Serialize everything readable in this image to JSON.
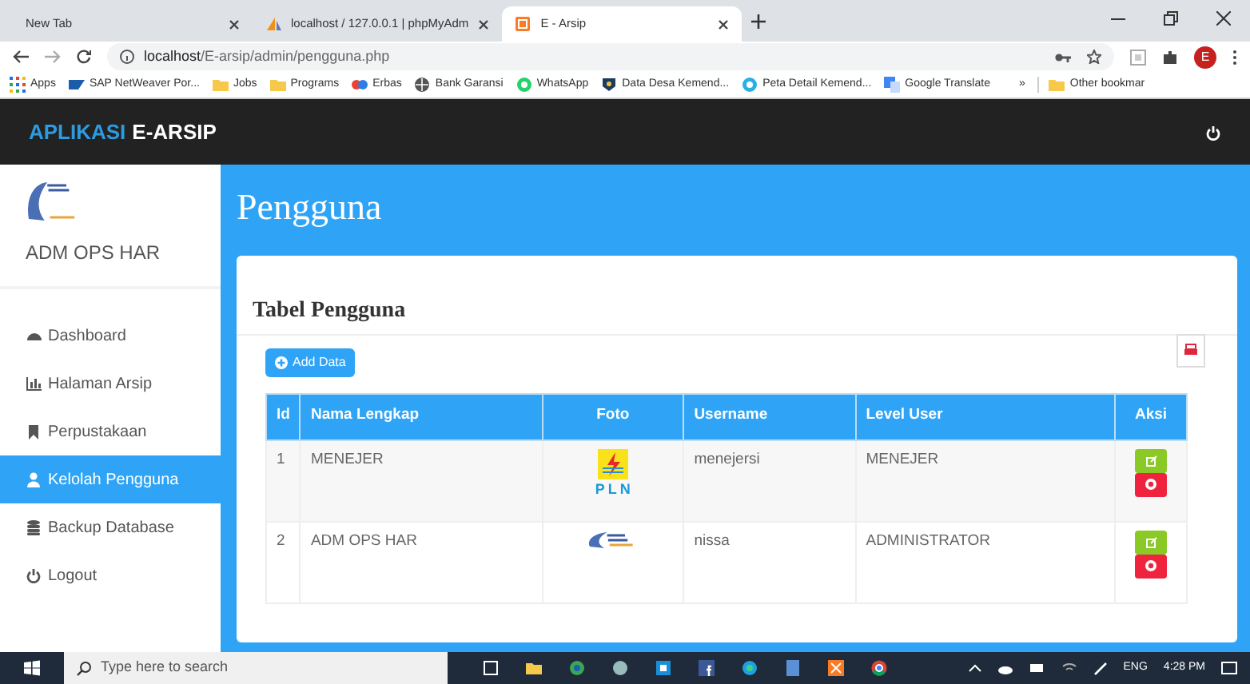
{
  "browser": {
    "tabs": [
      {
        "title": "New Tab",
        "selected": false
      },
      {
        "title": "localhost / 127.0.0.1 | phpMyAdm",
        "selected": false
      },
      {
        "title": "E - Arsip",
        "selected": true
      }
    ],
    "url_host": "localhost",
    "url_path": "/E-arsip/admin/pengguna.php",
    "avatar": "E",
    "bookmarks": [
      "Apps",
      "SAP NetWeaver Por...",
      "Jobs",
      "Programs",
      "Erbas",
      "Bank Garansi",
      "WhatsApp",
      "Data Desa Kemend...",
      "Peta Detail Kemend...",
      "Google Translate"
    ],
    "overflow": "»",
    "other_bookmarks": "Other bookmar"
  },
  "navbar": {
    "brand_prefix": "APLIKASI",
    "brand_name": "E-ARSIP"
  },
  "sidebar": {
    "user": "ADM OPS HAR",
    "items": [
      {
        "label": "Dashboard",
        "selected": false
      },
      {
        "label": "Halaman Arsip",
        "selected": false
      },
      {
        "label": "Perpustakaan",
        "selected": false
      },
      {
        "label": "Kelolah Pengguna",
        "selected": true
      },
      {
        "label": "Backup Database",
        "selected": false
      },
      {
        "label": "Logout",
        "selected": false
      }
    ]
  },
  "page_title": "Pengguna",
  "card": {
    "title": "Tabel Pengguna",
    "add_button": "Add Data",
    "table": {
      "columns": [
        "Id",
        "Nama Lengkap",
        "Foto",
        "Username",
        "Level User",
        "Aksi"
      ],
      "rows": [
        {
          "id": "1",
          "name": "MENEJER",
          "photo_text": "PLN",
          "username": "menejersi",
          "level_user": "MENEJER"
        },
        {
          "id": "2",
          "name": "ADM OPS HAR",
          "username": "nissa",
          "level_user": "ADMINISTRATOR"
        }
      ]
    }
  },
  "taskbar": {
    "search_placeholder": "Type here to search",
    "language": "ENG",
    "time": "4:28 PM"
  }
}
